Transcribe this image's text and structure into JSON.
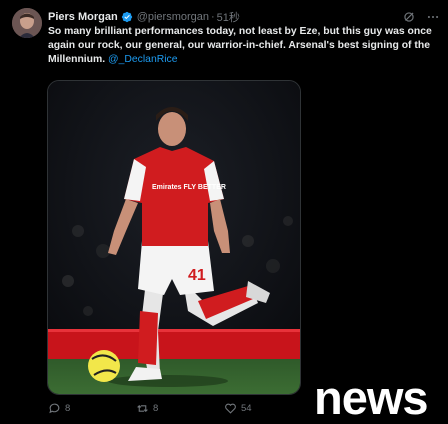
{
  "tweet": {
    "author_name": "Piers Morgan",
    "author_handle": "@piersmorgan",
    "separator": "·",
    "timestamp": "51秒",
    "text_main": "So many brilliant performances today, not least by Eze, but this guy was once again our rock, our general, our warrior-in-chief. Arsenal's best signing of the Millennium.",
    "mention": "@_DeclanRice",
    "media": {
      "shirt_sponsor": "Emirates FLY BETTER",
      "shirt_number": "41"
    }
  },
  "actions": {
    "replies": "8",
    "retweets": "8",
    "likes": "54"
  },
  "watermark": "news",
  "colors": {
    "background": "#000000",
    "text": "#e7e9ea",
    "muted": "#71767b",
    "link": "#1d9bf0",
    "verified": "#1d9bf0",
    "arsenal_red": "#d01c1f"
  },
  "icons": [
    "verified-badge-icon",
    "grok-icon",
    "more-icon",
    "reply-icon",
    "retweet-icon",
    "like-icon"
  ]
}
